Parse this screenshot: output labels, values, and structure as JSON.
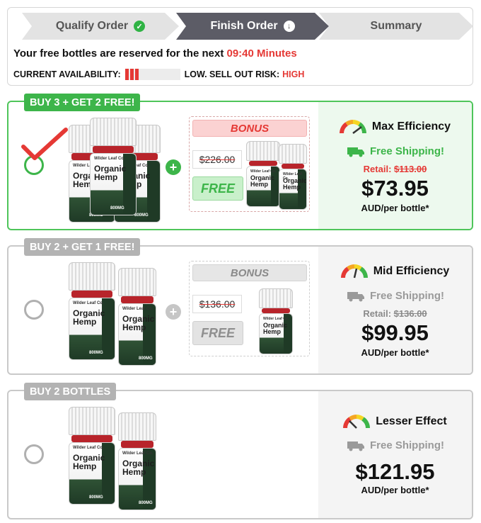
{
  "steps": [
    {
      "label": "Qualify Order"
    },
    {
      "label": "Finish Order"
    },
    {
      "label": "Summary"
    }
  ],
  "reserve": {
    "text": "Your free bottles are reserved for the next",
    "timer": "09:40 Minutes"
  },
  "availability": {
    "label": "CURRENT AVAILABILITY:",
    "risk_label": "LOW. SELL OUT RISK:",
    "risk_value": "HIGH",
    "level": 0.25
  },
  "colors": {
    "accent_green": "#3db54a",
    "alert_red": "#e53935",
    "step_active": "#5c5c66"
  },
  "product": {
    "brand": "Wilder Leaf Co.",
    "name_line1": "Organic",
    "name_line2": "Hemp",
    "dose": "800MG"
  },
  "offers": [
    {
      "tag": "BUY 3 + GET 2 FREE!",
      "bonus_title": "BONUS",
      "bonus_old_price": "$226.00",
      "bonus_free": "FREE",
      "efficiency": "Max Efficiency",
      "shipping": "Free Shipping!",
      "retail_label": "Retail:",
      "retail_price": "$113.00",
      "price": "$73.95",
      "per": "AUD/per bottle*",
      "selected": true
    },
    {
      "tag": "BUY 2 + GET 1 FREE!",
      "bonus_title": "BONUS",
      "bonus_old_price": "$136.00",
      "bonus_free": "FREE",
      "efficiency": "Mid Efficiency",
      "shipping": "Free Shipping!",
      "retail_label": "Retail:",
      "retail_price": "$136.00",
      "price": "$99.95",
      "per": "AUD/per bottle*",
      "selected": false
    },
    {
      "tag": "BUY 2 BOTTLES",
      "efficiency": "Lesser Effect",
      "shipping": "Free Shipping!",
      "price": "$121.95",
      "per": "AUD/per bottle*",
      "selected": false
    }
  ]
}
